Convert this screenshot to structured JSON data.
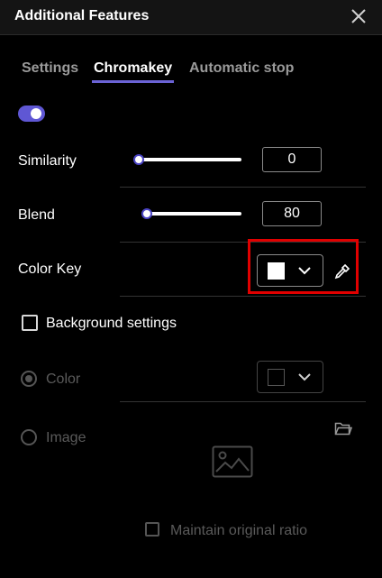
{
  "window": {
    "title": "Additional Features",
    "close_icon": "close-icon"
  },
  "tabs": [
    {
      "label": "Settings",
      "active": false
    },
    {
      "label": "Chromakey",
      "active": true
    },
    {
      "label": "Automatic stop",
      "active": false
    }
  ],
  "chromakey_toggle": {
    "on": true
  },
  "similarity": {
    "label": "Similarity",
    "value": "0"
  },
  "blend": {
    "label": "Blend",
    "value": "80"
  },
  "color_key": {
    "label": "Color Key",
    "swatch_color": "#ffffff",
    "eyedropper_icon": "eyedropper-icon",
    "highlight_color": "#e00000"
  },
  "background_settings": {
    "label": "Background settings",
    "checked": false
  },
  "background_color": {
    "label": "Color",
    "selected": true,
    "swatch_color": "#000000"
  },
  "background_image": {
    "label": "Image",
    "selected": false,
    "folder_icon": "folder-icon",
    "placeholder_icon": "image-placeholder-icon"
  },
  "maintain_ratio": {
    "label": "Maintain original ratio",
    "checked": false
  },
  "colors": {
    "accent": "#5f57d4",
    "background": "#000000",
    "disabled": "#555555"
  }
}
